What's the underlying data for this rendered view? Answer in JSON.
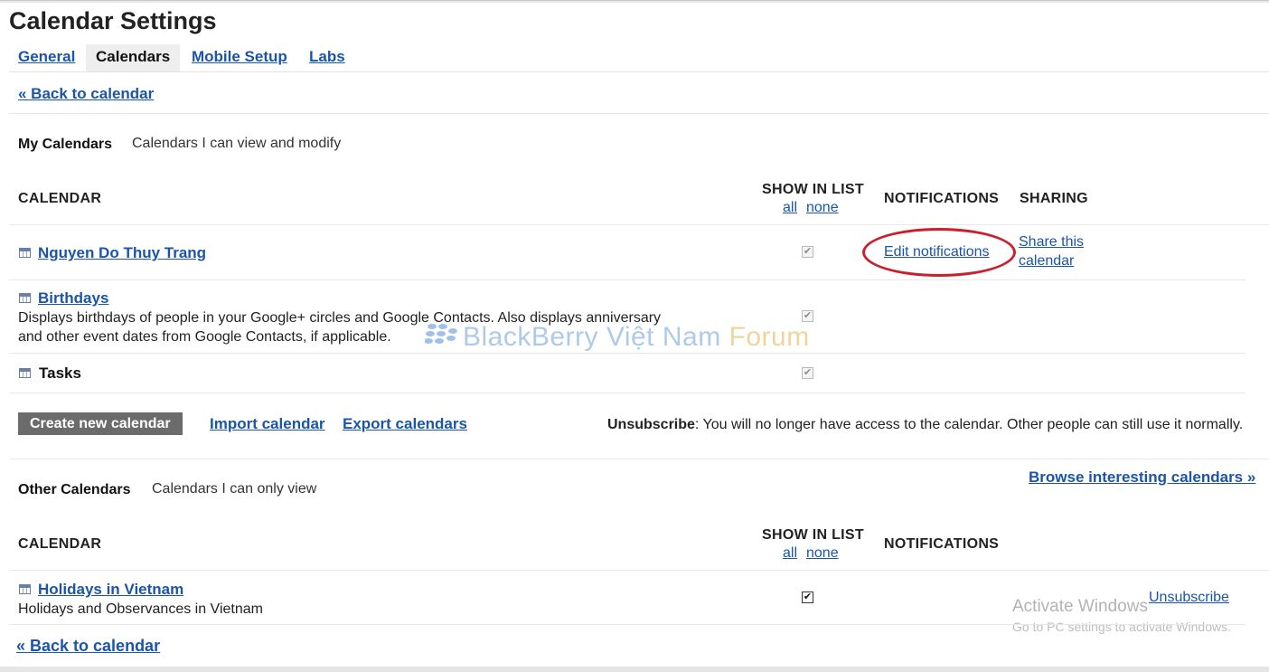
{
  "page_title": "Calendar Settings",
  "tabs": [
    {
      "label": "General",
      "active": false
    },
    {
      "label": "Calendars",
      "active": true
    },
    {
      "label": "Mobile Setup",
      "active": false
    },
    {
      "label": "Labs",
      "active": false
    }
  ],
  "back_link": "« Back to calendar",
  "my_calendars": {
    "title": "My Calendars",
    "subtitle": "Calendars I can view and modify",
    "headers": {
      "calendar": "CALENDAR",
      "show_in_list": "SHOW IN LIST",
      "all": "all",
      "none": "none",
      "notifications": "NOTIFICATIONS",
      "sharing": "SHARING"
    },
    "rows": [
      {
        "name": "Nguyen Do Thuy Trang",
        "checked": true,
        "notifications_link": "Edit notifications",
        "share_line1": "Share this",
        "share_line2": "calendar"
      },
      {
        "name": "Birthdays",
        "description_line1": "Displays birthdays of people in your Google+ circles and Google Contacts. Also displays anniversary",
        "description_line2": "and other event dates from Google Contacts, if applicable.",
        "checked": true
      },
      {
        "name": "Tasks",
        "checked": true
      }
    ],
    "actions": {
      "create": "Create new calendar",
      "import": "Import calendar",
      "export": "Export calendars"
    },
    "unsubscribe_note_label": "Unsubscribe",
    "unsubscribe_note_text": ": You will no longer have access to the calendar. Other people can still use it normally."
  },
  "other_calendars": {
    "title": "Other Calendars",
    "subtitle": "Calendars I can only view",
    "browse_link": "Browse interesting calendars »",
    "headers": {
      "calendar": "CALENDAR",
      "show_in_list": "SHOW IN LIST",
      "all": "all",
      "none": "none",
      "notifications": "NOTIFICATIONS"
    },
    "rows": [
      {
        "name": "Holidays in Vietnam",
        "description": "Holidays and Observances in Vietnam",
        "checked": true,
        "unsubscribe": "Unsubscribe"
      }
    ]
  },
  "watermark": {
    "part1": "BlackBerry Việt Nam ",
    "part2": "Forum"
  },
  "activate_windows": {
    "line1": "Activate Windows",
    "line2": "Go to PC settings to activate Windows."
  },
  "colors": {
    "link": "#1a55a8",
    "button": "#6b6b6b",
    "annotation": "#c8202c"
  },
  "check_mark": "✔"
}
